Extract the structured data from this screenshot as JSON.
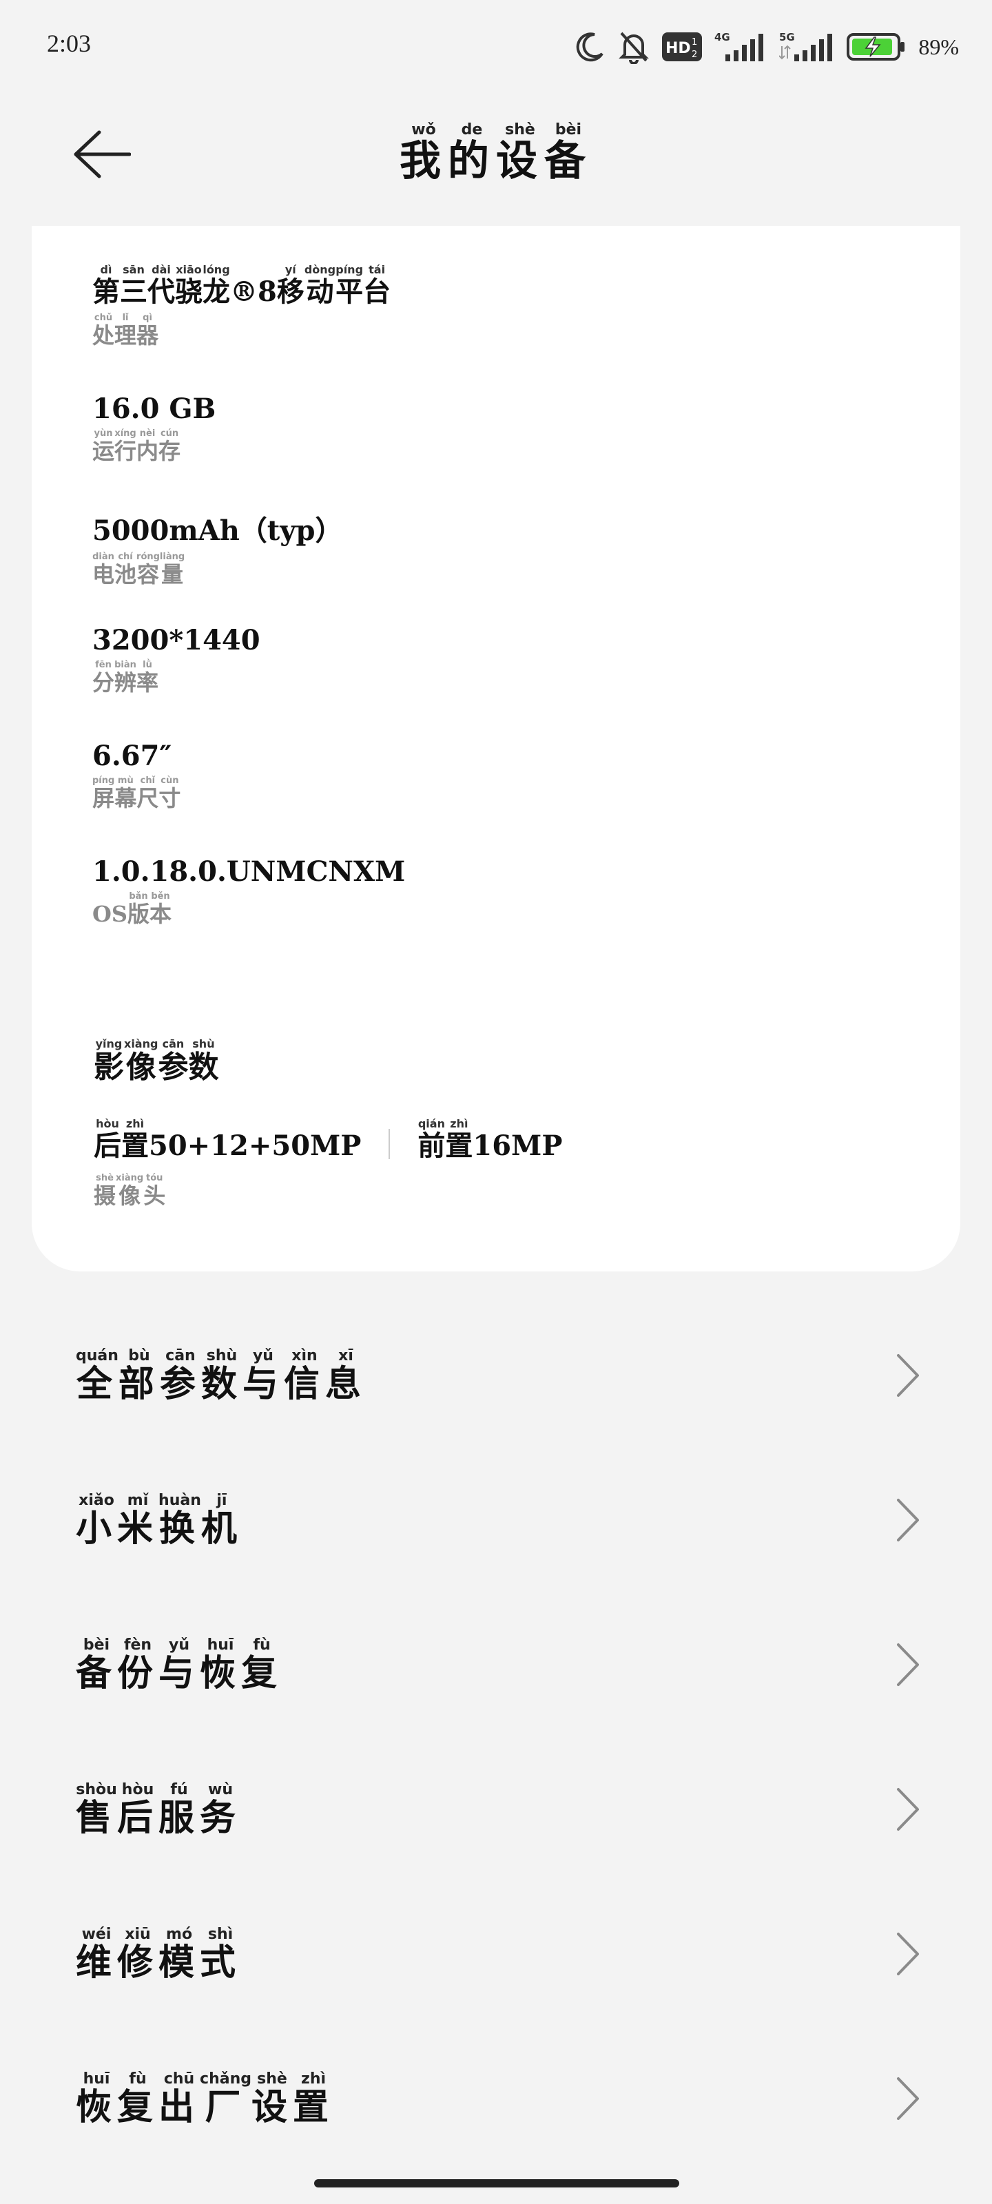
{
  "status": {
    "time": "2:03",
    "hd_label": "HD",
    "net_4g": "4G",
    "net_5g": "5G",
    "battery_pct": "89%"
  },
  "header": {
    "title_chars": [
      {
        "c": "我",
        "p": "wǒ"
      },
      {
        "c": "的",
        "p": "de"
      },
      {
        "c": "设",
        "p": "shè"
      },
      {
        "c": "备",
        "p": "bèi"
      }
    ]
  },
  "specs": [
    {
      "value": [
        {
          "c": "第",
          "p": "dì"
        },
        {
          "c": "三",
          "p": "sān"
        },
        {
          "c": "代",
          "p": "dài"
        },
        {
          "c": "骁",
          "p": "xiāo"
        },
        {
          "c": "龙",
          "p": "lóng"
        },
        {
          "c": "®8",
          "p": ""
        },
        {
          "c": "移",
          "p": "yí"
        },
        {
          "c": "动",
          "p": "dòng"
        },
        {
          "c": "平",
          "p": "píng"
        },
        {
          "c": "台",
          "p": "tái"
        }
      ],
      "label": [
        {
          "c": "处",
          "p": "chǔ"
        },
        {
          "c": "理",
          "p": "lǐ"
        },
        {
          "c": "器",
          "p": "qì"
        }
      ]
    },
    {
      "value": [
        {
          "c": "16.0  GB",
          "p": ""
        }
      ],
      "label": [
        {
          "c": "运",
          "p": "yùn"
        },
        {
          "c": "行",
          "p": "xíng"
        },
        {
          "c": "内",
          "p": "nèi"
        },
        {
          "c": "存",
          "p": "cún"
        }
      ]
    },
    {
      "value": [
        {
          "c": "5000mAh（typ）",
          "p": ""
        }
      ],
      "label": [
        {
          "c": "电",
          "p": "diàn"
        },
        {
          "c": "池",
          "p": "chí"
        },
        {
          "c": "容",
          "p": "róng"
        },
        {
          "c": "量",
          "p": "liàng"
        }
      ]
    },
    {
      "value": [
        {
          "c": "3200*1440",
          "p": ""
        }
      ],
      "label": [
        {
          "c": "分",
          "p": "fēn"
        },
        {
          "c": "辨",
          "p": "biàn"
        },
        {
          "c": "率",
          "p": "lǜ"
        }
      ]
    },
    {
      "value": [
        {
          "c": "6.67″",
          "p": ""
        }
      ],
      "label": [
        {
          "c": "屏",
          "p": "píng"
        },
        {
          "c": "幕",
          "p": "mù"
        },
        {
          "c": "尺",
          "p": "chǐ"
        },
        {
          "c": "寸",
          "p": "cùn"
        }
      ]
    },
    {
      "value": [
        {
          "c": "1.0.18.0.UNMCNXM",
          "p": ""
        }
      ],
      "label": [
        {
          "c": "OS",
          "p": ""
        },
        {
          "c": "版",
          "p": "bǎn"
        },
        {
          "c": "本",
          "p": "běn"
        }
      ]
    }
  ],
  "camera": {
    "title": [
      {
        "c": "影",
        "p": "yǐng"
      },
      {
        "c": "像",
        "p": "xiàng"
      },
      {
        "c": "参",
        "p": "cān"
      },
      {
        "c": "数",
        "p": "shù"
      }
    ],
    "rear": [
      {
        "c": "后",
        "p": "hòu"
      },
      {
        "c": "置",
        "p": "zhì"
      },
      {
        "c": "50+12+50MP",
        "p": ""
      }
    ],
    "front": [
      {
        "c": "前",
        "p": "qián"
      },
      {
        "c": "置",
        "p": "zhì"
      },
      {
        "c": "16MP",
        "p": ""
      }
    ],
    "label": [
      {
        "c": "摄",
        "p": "shè"
      },
      {
        "c": "像",
        "p": "xiàng"
      },
      {
        "c": "头",
        "p": "tóu"
      }
    ]
  },
  "menu": [
    {
      "id": "all-specs",
      "chars": [
        {
          "c": "全",
          "p": "quán"
        },
        {
          "c": "部",
          "p": "bù"
        },
        {
          "c": "参",
          "p": "cān"
        },
        {
          "c": "数",
          "p": "shù"
        },
        {
          "c": "与",
          "p": "yǔ"
        },
        {
          "c": "信",
          "p": "xìn"
        },
        {
          "c": "息",
          "p": "xī"
        }
      ]
    },
    {
      "id": "mi-mover",
      "chars": [
        {
          "c": "小",
          "p": "xiǎo"
        },
        {
          "c": "米",
          "p": "mǐ"
        },
        {
          "c": "换",
          "p": "huàn"
        },
        {
          "c": "机",
          "p": "jī"
        }
      ]
    },
    {
      "id": "backup-restore",
      "chars": [
        {
          "c": "备",
          "p": "bèi"
        },
        {
          "c": "份",
          "p": "fèn"
        },
        {
          "c": "与",
          "p": "yǔ"
        },
        {
          "c": "恢",
          "p": "huī"
        },
        {
          "c": "复",
          "p": "fù"
        }
      ]
    },
    {
      "id": "after-sales",
      "chars": [
        {
          "c": "售",
          "p": "shòu"
        },
        {
          "c": "后",
          "p": "hòu"
        },
        {
          "c": "服",
          "p": "fú"
        },
        {
          "c": "务",
          "p": "wù"
        }
      ]
    },
    {
      "id": "repair-mode",
      "chars": [
        {
          "c": "维",
          "p": "wéi"
        },
        {
          "c": "修",
          "p": "xiū"
        },
        {
          "c": "模",
          "p": "mó"
        },
        {
          "c": "式",
          "p": "shì"
        }
      ]
    },
    {
      "id": "factory-reset",
      "chars": [
        {
          "c": "恢",
          "p": "huī"
        },
        {
          "c": "复",
          "p": "fù"
        },
        {
          "c": "出",
          "p": "chū"
        },
        {
          "c": "厂",
          "p": "chǎng"
        },
        {
          "c": "设",
          "p": "shè"
        },
        {
          "c": "置",
          "p": "zhì"
        }
      ]
    }
  ]
}
